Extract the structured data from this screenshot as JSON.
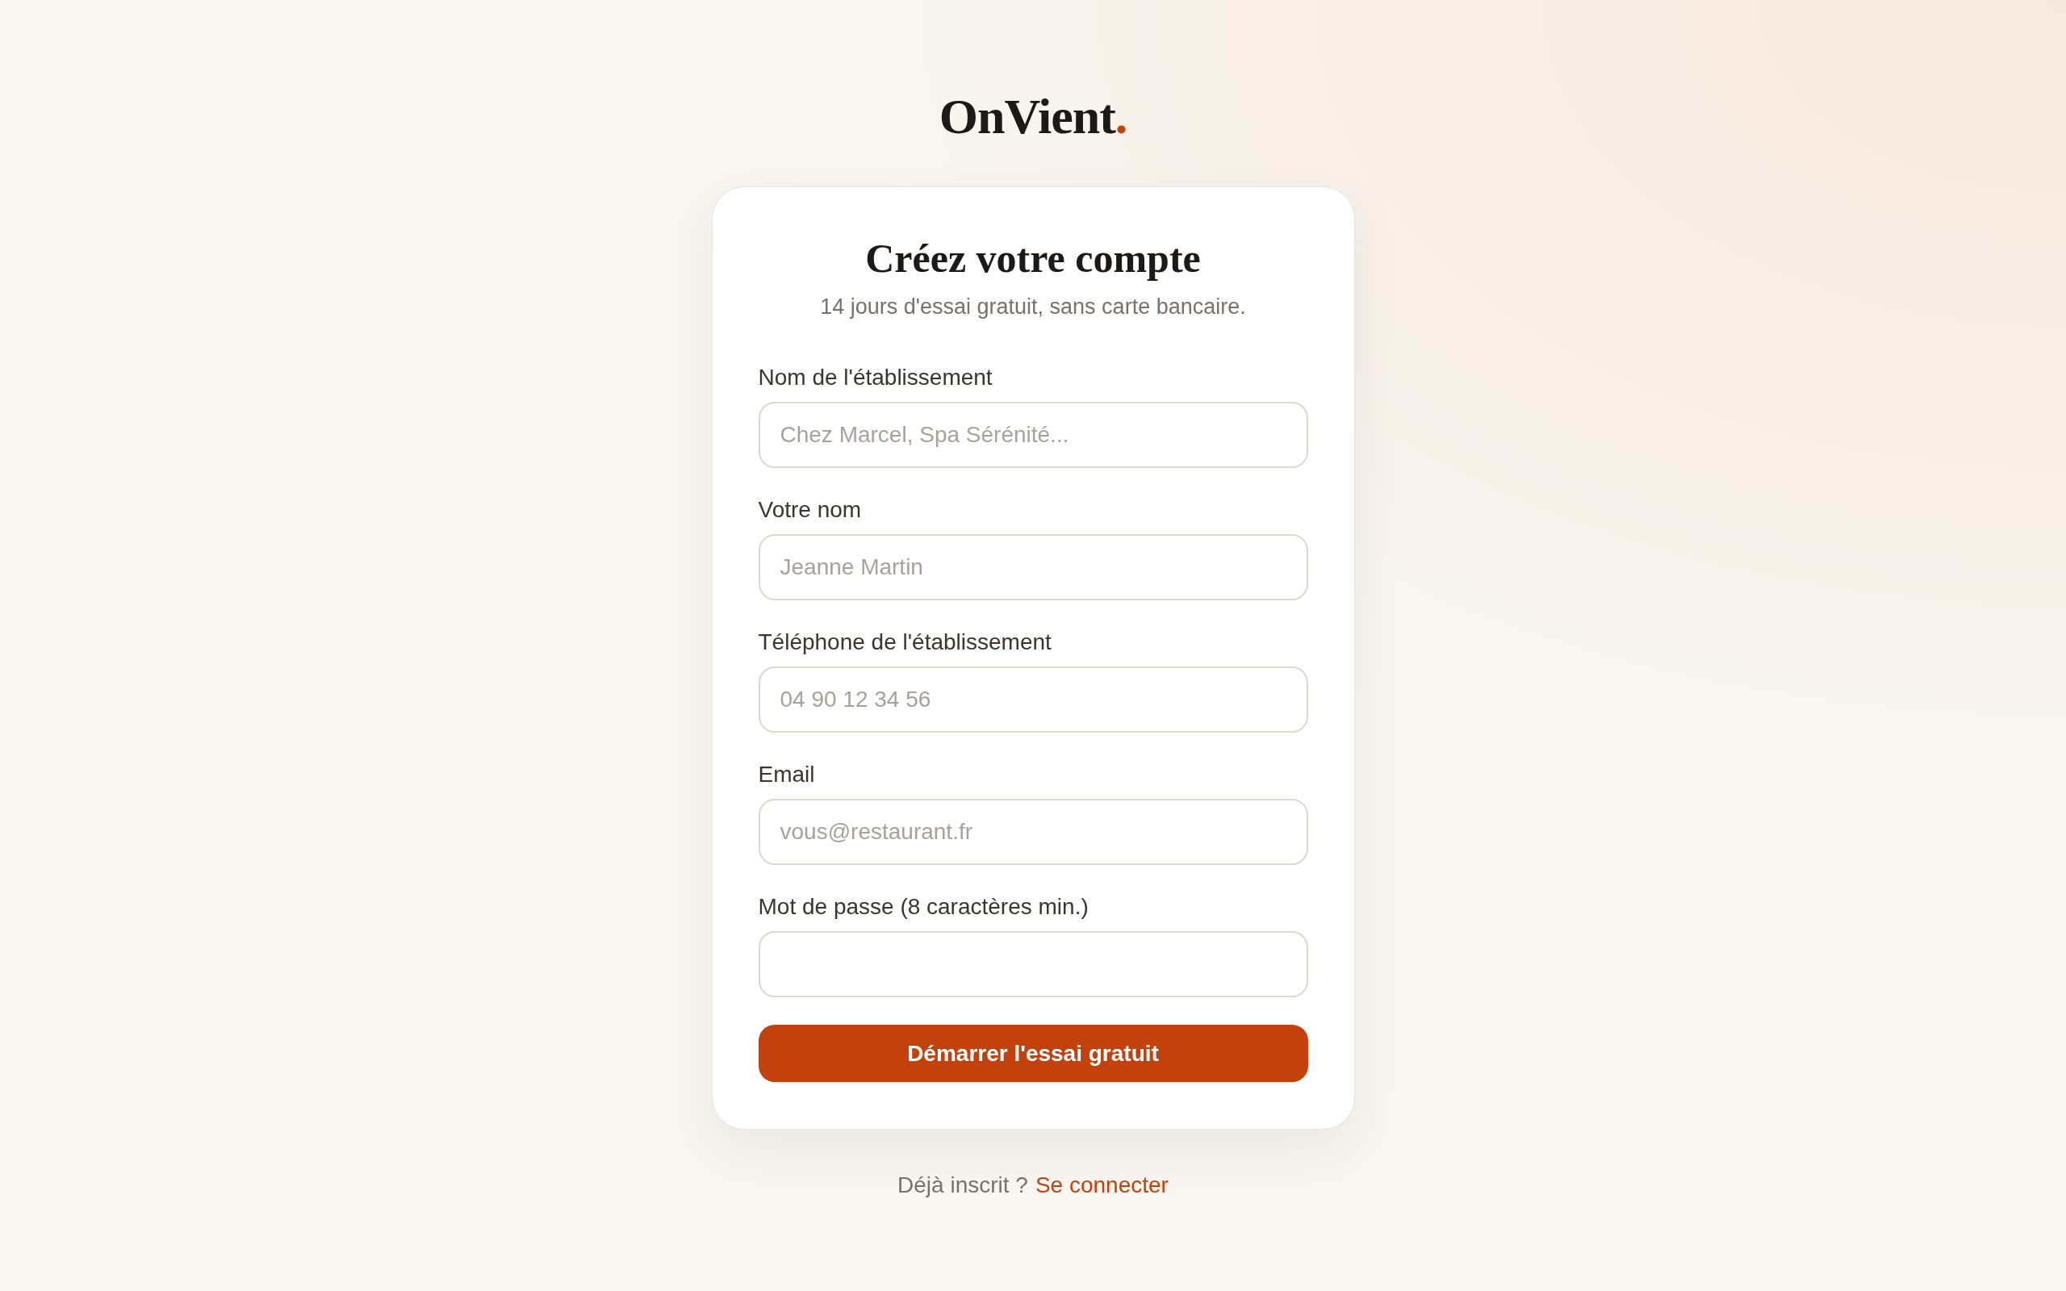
{
  "logo": {
    "name": "OnVient",
    "accent": "."
  },
  "card": {
    "title": "Créez votre compte",
    "subtitle": "14 jours d'essai gratuit, sans carte bancaire."
  },
  "fields": [
    {
      "label": "Nom de l'établissement",
      "placeholder": "Chez Marcel, Spa Sérénité..."
    },
    {
      "label": "Votre nom",
      "placeholder": "Jeanne Martin"
    },
    {
      "label": "Téléphone de l'établissement",
      "placeholder": "04 90 12 34 56"
    },
    {
      "label": "Email",
      "placeholder": "vous@restaurant.fr"
    },
    {
      "label": "Mot de passe (8 caractères min.)"
    }
  ],
  "submit_button": "Démarrer l'essai gratuit",
  "footer": {
    "text": "Déjà inscrit ?",
    "link": "Se connecter"
  }
}
